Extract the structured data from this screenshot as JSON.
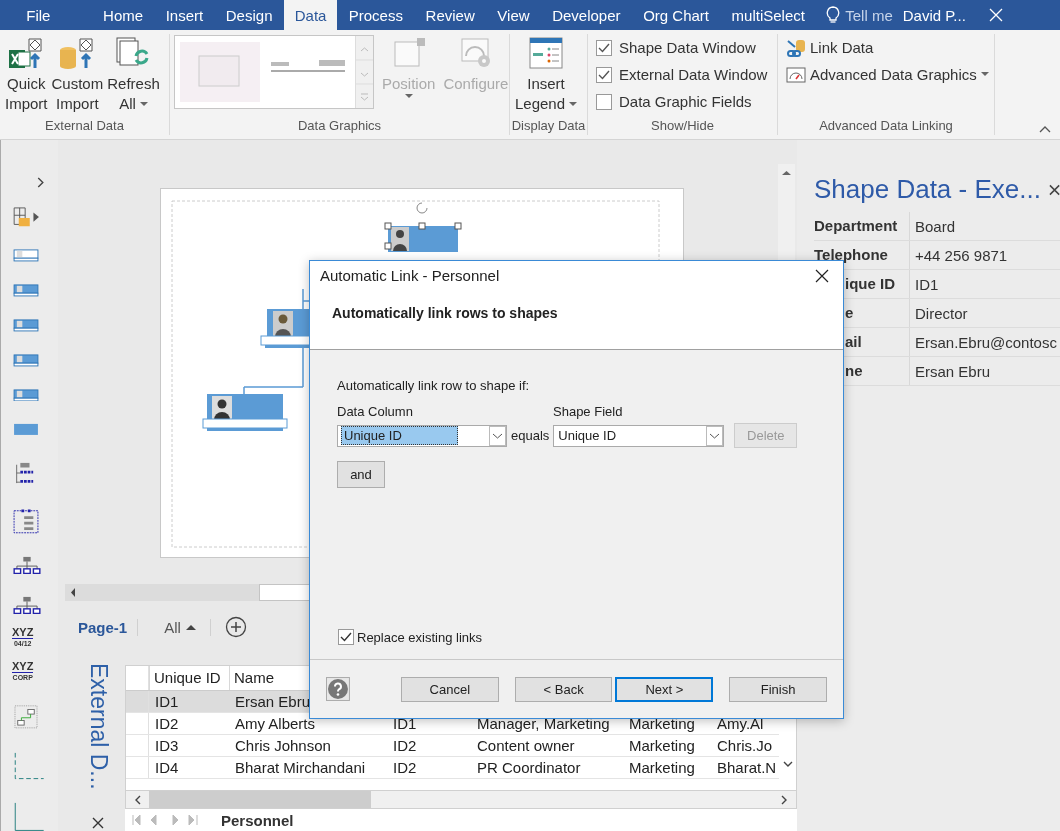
{
  "title_bar": {
    "tabs": [
      {
        "label": "File",
        "selected": false
      },
      {
        "label": "Home",
        "selected": false
      },
      {
        "label": "Insert",
        "selected": false
      },
      {
        "label": "Design",
        "selected": false
      },
      {
        "label": "Data",
        "selected": true
      },
      {
        "label": "Process",
        "selected": false
      },
      {
        "label": "Review",
        "selected": false
      },
      {
        "label": "View",
        "selected": false
      },
      {
        "label": "Developer",
        "selected": false
      },
      {
        "label": "Org Chart",
        "selected": false
      },
      {
        "label": "multiSelect",
        "selected": false
      }
    ],
    "tell_me": "Tell me",
    "user": "David P..."
  },
  "ribbon": {
    "groups": [
      {
        "label": "External Data",
        "items": [
          {
            "kind": "large",
            "lines": [
              "Quick",
              "Import"
            ],
            "dropdown": false,
            "disabled": false
          },
          {
            "kind": "large",
            "lines": [
              "Custom",
              "Import"
            ],
            "dropdown": false,
            "disabled": false
          },
          {
            "kind": "large",
            "lines": [
              "Refresh",
              "All"
            ],
            "dropdown": true,
            "disabled": false
          }
        ]
      },
      {
        "label": "Data Graphics",
        "items": [
          {
            "kind": "gallery"
          },
          {
            "kind": "large",
            "lines": [
              "Position"
            ],
            "dropdown": true,
            "disabled": true
          },
          {
            "kind": "large",
            "lines": [
              "Configure"
            ],
            "dropdown": false,
            "disabled": true
          }
        ]
      },
      {
        "label": "Display Data",
        "items": [
          {
            "kind": "large",
            "lines": [
              "Insert",
              "Legend"
            ],
            "dropdown": true,
            "disabled": false
          }
        ]
      },
      {
        "label": "Show/Hide",
        "items": [
          {
            "kind": "check",
            "label": "Shape Data Window",
            "checked": true
          },
          {
            "kind": "check",
            "label": "External Data Window",
            "checked": true
          },
          {
            "kind": "check",
            "label": "Data Graphic Fields",
            "checked": false
          }
        ]
      },
      {
        "label": "Advanced Data Linking",
        "items": [
          {
            "kind": "link",
            "label": "Link Data",
            "dropdown": false
          },
          {
            "kind": "link",
            "label": "Advanced Data Graphics",
            "dropdown": true
          }
        ]
      }
    ]
  },
  "stencil": {
    "stamps": [
      {
        "top": "XYZ",
        "bottom": "04/12"
      },
      {
        "top": "XYZ",
        "bottom": "CORP"
      }
    ]
  },
  "page_tabs": [
    {
      "label": "Page-1",
      "selected": true
    }
  ],
  "all_pages": "All",
  "shape_data": {
    "title": "Shape Data - Exe...",
    "rows": [
      {
        "label": "Department",
        "value": "Board",
        "kind": "full"
      },
      {
        "label": "Telephone",
        "value": "+44 256 9871",
        "kind": "full"
      },
      {
        "label": "ique ID",
        "value": "ID1",
        "kind": "partial"
      },
      {
        "label": "e",
        "value": "Director",
        "kind": "partial"
      },
      {
        "label": "ail",
        "value": "Ersan.Ebru@contosc",
        "kind": "partial"
      },
      {
        "label": "ne",
        "value": "Ersan Ebru",
        "kind": "partial"
      }
    ]
  },
  "dialog": {
    "title": "Automatic Link - Personnel",
    "heading": "Automatically link rows to shapes",
    "condition_label": "Automatically link row to shape if:",
    "data_column_label": "Data Column",
    "shape_field_label": "Shape Field",
    "data_column": "Unique ID",
    "equals": "equals",
    "shape_field": "Unique ID",
    "delete": {
      "label": "Delete",
      "disabled": true
    },
    "and": "and",
    "replace": {
      "label": "Replace existing links",
      "checked": true
    },
    "buttons": [
      {
        "label": "Cancel",
        "focused": false
      },
      {
        "label": "< Back",
        "focused": false
      },
      {
        "label": "Next >",
        "focused": true
      },
      {
        "label": "Finish",
        "focused": false
      }
    ]
  },
  "external_data": {
    "title": "External D...",
    "columns": [
      "Unique ID",
      "Name"
    ],
    "rows": [
      {
        "cells": [
          "ID1",
          "Ersan Ebru"
        ],
        "selected": true
      },
      {
        "cells": [
          "ID2",
          "Amy Alberts",
          "ID1",
          "Manager, Marketing",
          "Marketing",
          "Amy.Al"
        ],
        "selected": false
      },
      {
        "cells": [
          "ID3",
          "Chris Johnson",
          "ID2",
          "Content owner",
          "Marketing",
          "Chris.Jo"
        ],
        "selected": false
      },
      {
        "cells": [
          "ID4",
          "Bharat Mirchandani",
          "ID2",
          "PR Coordinator",
          "Marketing",
          "Bharat.N"
        ],
        "selected": false
      }
    ],
    "sheet_tabs": [
      {
        "label": "Personnel",
        "selected": true
      }
    ]
  }
}
